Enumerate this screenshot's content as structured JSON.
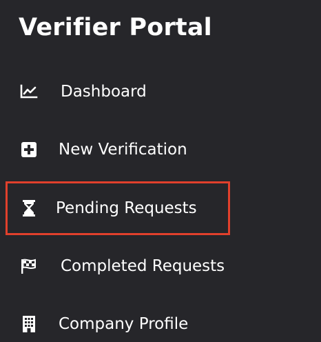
{
  "sidebar": {
    "title": "Verifier Portal",
    "items": [
      {
        "label": "Dashboard",
        "icon": "chart-line-icon"
      },
      {
        "label": "New Verification",
        "icon": "plus-square-icon"
      },
      {
        "label": "Pending Requests",
        "icon": "hourglass-icon",
        "highlighted": true
      },
      {
        "label": "Completed Requests",
        "icon": "checkered-flag-icon"
      },
      {
        "label": "Company Profile",
        "icon": "building-icon"
      }
    ]
  },
  "colors": {
    "background": "#26262a",
    "text": "#ffffff",
    "highlight_border": "#e1402c"
  }
}
